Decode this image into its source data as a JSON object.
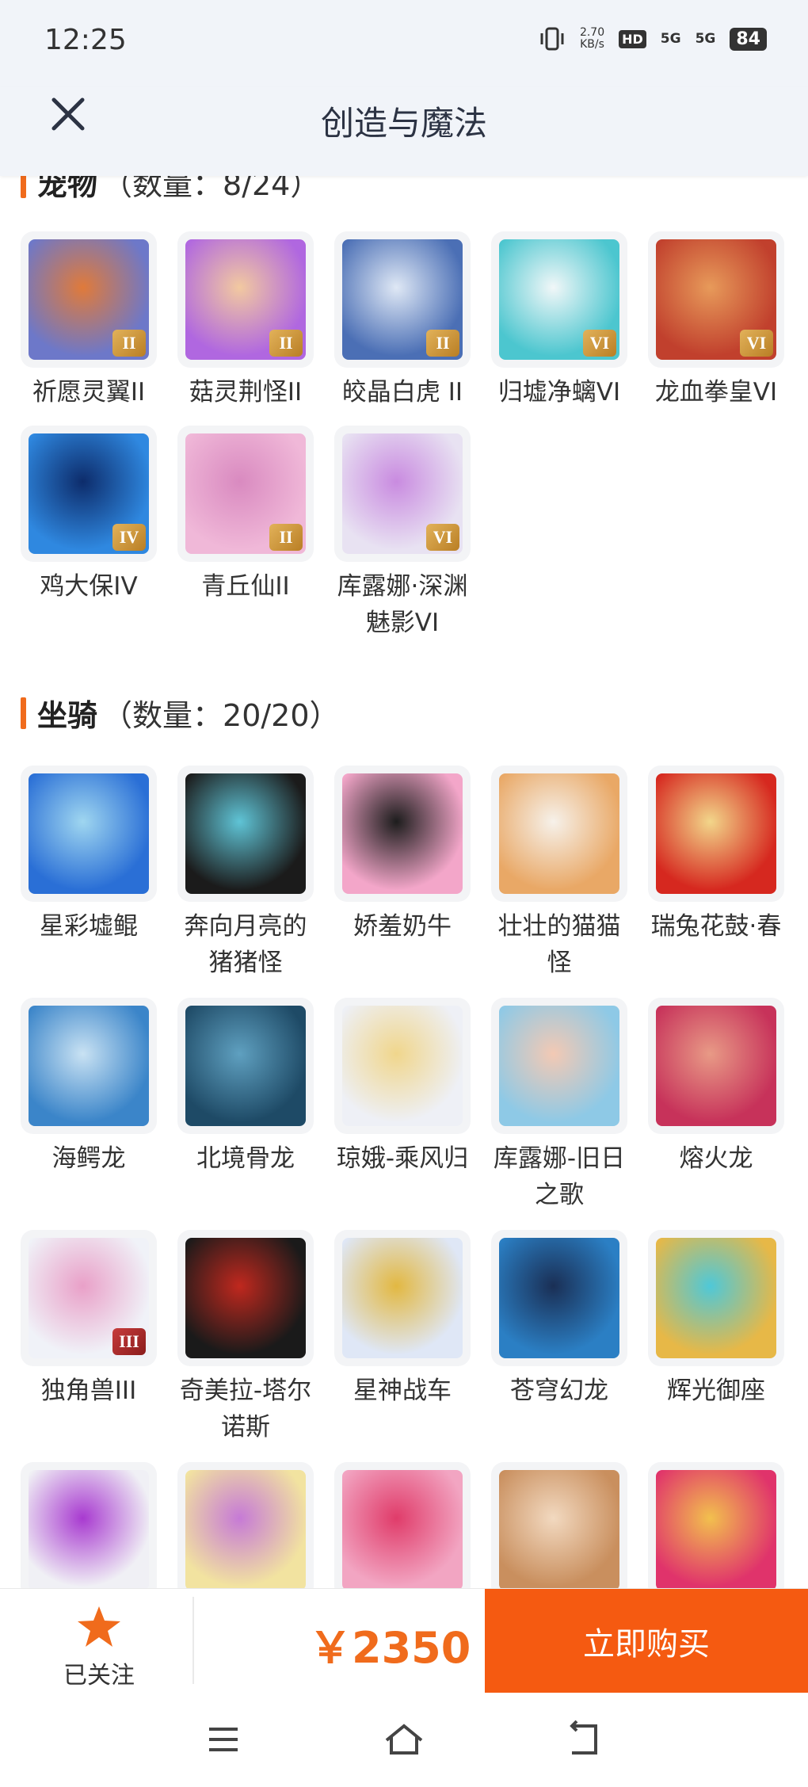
{
  "status": {
    "time": "12:25",
    "speed_top": "2.70",
    "speed_unit": "KB/s",
    "hd": "HD",
    "sim1": "5G",
    "sim2": "5G",
    "battery": "84"
  },
  "header": {
    "title": "创造与魔法",
    "close_icon": "close-icon"
  },
  "pets": {
    "name": "宠物",
    "count": "（数量：8/24）",
    "items": [
      {
        "name": "祈愿灵翼II",
        "tier": "II",
        "c1": "#6d78c9",
        "c2": "#e07a3a"
      },
      {
        "name": "菇灵荆怪II",
        "tier": "II",
        "c1": "#b067e0",
        "c2": "#f2c9a0"
      },
      {
        "name": "皎晶白虎 II",
        "tier": "II",
        "c1": "#4b6fb5",
        "c2": "#dfe8f5"
      },
      {
        "name": "归墟净螭VI",
        "tier": "VI",
        "c1": "#4cc6cf",
        "c2": "#f1f7f8"
      },
      {
        "name": "龙血拳皇VI",
        "tier": "VI",
        "c1": "#c1402d",
        "c2": "#e79a5a"
      },
      {
        "name": "鸡大保IV",
        "tier": "IV",
        "c1": "#2f88e0",
        "c2": "#0d2c6b"
      },
      {
        "name": "青丘仙II",
        "tier": "II",
        "c1": "#f0b8d8",
        "c2": "#d98ac0"
      },
      {
        "name": "库露娜·深渊魅影VI",
        "tier": "VI",
        "c1": "#e8e2f2",
        "c2": "#c98be0"
      }
    ]
  },
  "mounts": {
    "name": "坐骑",
    "count": "（数量：20/20）",
    "items": [
      {
        "name": "星彩墟鲲",
        "c1": "#2a6fd6",
        "c2": "#9fd6f0"
      },
      {
        "name": "奔向月亮的猪猪怪",
        "c1": "#1b1b1b",
        "c2": "#5fc4d6"
      },
      {
        "name": "娇羞奶牛",
        "c1": "#f3a6c9",
        "c2": "#1d1d1d"
      },
      {
        "name": "壮壮的猫猫怪",
        "c1": "#e9a866",
        "c2": "#f6f1ea"
      },
      {
        "name": "瑞兔花鼓·春",
        "c1": "#d6281f",
        "c2": "#f2d68a"
      },
      {
        "name": "海鳄龙",
        "c1": "#3b85c9",
        "c2": "#c9e2f3"
      },
      {
        "name": "北境骨龙",
        "c1": "#1e4a66",
        "c2": "#5fa0c0"
      },
      {
        "name": "琼娥-乘风归",
        "c1": "#eef0f6",
        "c2": "#f0d68c"
      },
      {
        "name": "库露娜-旧日之歌",
        "c1": "#8ec9e6",
        "c2": "#f3c9b4"
      },
      {
        "name": "熔火龙",
        "c1": "#c7325a",
        "c2": "#e89a86"
      },
      {
        "name": "独角兽III",
        "tier": "III",
        "c1": "#f0f2f8",
        "c2": "#e9a0c8"
      },
      {
        "name": "奇美拉-塔尔诺斯",
        "c1": "#1a1a1a",
        "c2": "#c0281e"
      },
      {
        "name": "星神战车",
        "c1": "#dfe7f6",
        "c2": "#e2b842"
      },
      {
        "name": "苍穹幻龙",
        "c1": "#2b7fc4",
        "c2": "#1a2f55"
      },
      {
        "name": "辉光御座",
        "c1": "#e7b847",
        "c2": "#4fc8d8"
      },
      {
        "name": "",
        "c1": "#f0f0f5",
        "c2": "#a83ad0"
      },
      {
        "name": "",
        "c1": "#f2e3a0",
        "c2": "#c67ad6"
      },
      {
        "name": "",
        "c1": "#f2a5c2",
        "c2": "#e03c6a"
      },
      {
        "name": "",
        "c1": "#c98f5e",
        "c2": "#f2d9c0"
      },
      {
        "name": "",
        "c1": "#e0336b",
        "c2": "#f2c04e"
      }
    ]
  },
  "bottom": {
    "follow_label": "已关注",
    "price": "￥2350",
    "buy_label": "立即购买"
  }
}
